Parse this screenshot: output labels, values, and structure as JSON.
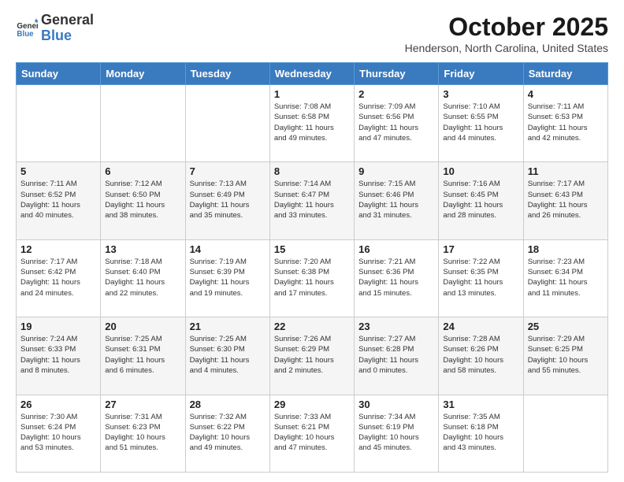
{
  "logo": {
    "general": "General",
    "blue": "Blue",
    "icon_color": "#3a7abf"
  },
  "title": "October 2025",
  "location": "Henderson, North Carolina, United States",
  "days_of_week": [
    "Sunday",
    "Monday",
    "Tuesday",
    "Wednesday",
    "Thursday",
    "Friday",
    "Saturday"
  ],
  "weeks": [
    [
      {
        "day": "",
        "info": ""
      },
      {
        "day": "",
        "info": ""
      },
      {
        "day": "",
        "info": ""
      },
      {
        "day": "1",
        "info": "Sunrise: 7:08 AM\nSunset: 6:58 PM\nDaylight: 11 hours\nand 49 minutes."
      },
      {
        "day": "2",
        "info": "Sunrise: 7:09 AM\nSunset: 6:56 PM\nDaylight: 11 hours\nand 47 minutes."
      },
      {
        "day": "3",
        "info": "Sunrise: 7:10 AM\nSunset: 6:55 PM\nDaylight: 11 hours\nand 44 minutes."
      },
      {
        "day": "4",
        "info": "Sunrise: 7:11 AM\nSunset: 6:53 PM\nDaylight: 11 hours\nand 42 minutes."
      }
    ],
    [
      {
        "day": "5",
        "info": "Sunrise: 7:11 AM\nSunset: 6:52 PM\nDaylight: 11 hours\nand 40 minutes."
      },
      {
        "day": "6",
        "info": "Sunrise: 7:12 AM\nSunset: 6:50 PM\nDaylight: 11 hours\nand 38 minutes."
      },
      {
        "day": "7",
        "info": "Sunrise: 7:13 AM\nSunset: 6:49 PM\nDaylight: 11 hours\nand 35 minutes."
      },
      {
        "day": "8",
        "info": "Sunrise: 7:14 AM\nSunset: 6:47 PM\nDaylight: 11 hours\nand 33 minutes."
      },
      {
        "day": "9",
        "info": "Sunrise: 7:15 AM\nSunset: 6:46 PM\nDaylight: 11 hours\nand 31 minutes."
      },
      {
        "day": "10",
        "info": "Sunrise: 7:16 AM\nSunset: 6:45 PM\nDaylight: 11 hours\nand 28 minutes."
      },
      {
        "day": "11",
        "info": "Sunrise: 7:17 AM\nSunset: 6:43 PM\nDaylight: 11 hours\nand 26 minutes."
      }
    ],
    [
      {
        "day": "12",
        "info": "Sunrise: 7:17 AM\nSunset: 6:42 PM\nDaylight: 11 hours\nand 24 minutes."
      },
      {
        "day": "13",
        "info": "Sunrise: 7:18 AM\nSunset: 6:40 PM\nDaylight: 11 hours\nand 22 minutes."
      },
      {
        "day": "14",
        "info": "Sunrise: 7:19 AM\nSunset: 6:39 PM\nDaylight: 11 hours\nand 19 minutes."
      },
      {
        "day": "15",
        "info": "Sunrise: 7:20 AM\nSunset: 6:38 PM\nDaylight: 11 hours\nand 17 minutes."
      },
      {
        "day": "16",
        "info": "Sunrise: 7:21 AM\nSunset: 6:36 PM\nDaylight: 11 hours\nand 15 minutes."
      },
      {
        "day": "17",
        "info": "Sunrise: 7:22 AM\nSunset: 6:35 PM\nDaylight: 11 hours\nand 13 minutes."
      },
      {
        "day": "18",
        "info": "Sunrise: 7:23 AM\nSunset: 6:34 PM\nDaylight: 11 hours\nand 11 minutes."
      }
    ],
    [
      {
        "day": "19",
        "info": "Sunrise: 7:24 AM\nSunset: 6:33 PM\nDaylight: 11 hours\nand 8 minutes."
      },
      {
        "day": "20",
        "info": "Sunrise: 7:25 AM\nSunset: 6:31 PM\nDaylight: 11 hours\nand 6 minutes."
      },
      {
        "day": "21",
        "info": "Sunrise: 7:25 AM\nSunset: 6:30 PM\nDaylight: 11 hours\nand 4 minutes."
      },
      {
        "day": "22",
        "info": "Sunrise: 7:26 AM\nSunset: 6:29 PM\nDaylight: 11 hours\nand 2 minutes."
      },
      {
        "day": "23",
        "info": "Sunrise: 7:27 AM\nSunset: 6:28 PM\nDaylight: 11 hours\nand 0 minutes."
      },
      {
        "day": "24",
        "info": "Sunrise: 7:28 AM\nSunset: 6:26 PM\nDaylight: 10 hours\nand 58 minutes."
      },
      {
        "day": "25",
        "info": "Sunrise: 7:29 AM\nSunset: 6:25 PM\nDaylight: 10 hours\nand 55 minutes."
      }
    ],
    [
      {
        "day": "26",
        "info": "Sunrise: 7:30 AM\nSunset: 6:24 PM\nDaylight: 10 hours\nand 53 minutes."
      },
      {
        "day": "27",
        "info": "Sunrise: 7:31 AM\nSunset: 6:23 PM\nDaylight: 10 hours\nand 51 minutes."
      },
      {
        "day": "28",
        "info": "Sunrise: 7:32 AM\nSunset: 6:22 PM\nDaylight: 10 hours\nand 49 minutes."
      },
      {
        "day": "29",
        "info": "Sunrise: 7:33 AM\nSunset: 6:21 PM\nDaylight: 10 hours\nand 47 minutes."
      },
      {
        "day": "30",
        "info": "Sunrise: 7:34 AM\nSunset: 6:19 PM\nDaylight: 10 hours\nand 45 minutes."
      },
      {
        "day": "31",
        "info": "Sunrise: 7:35 AM\nSunset: 6:18 PM\nDaylight: 10 hours\nand 43 minutes."
      },
      {
        "day": "",
        "info": ""
      }
    ]
  ]
}
